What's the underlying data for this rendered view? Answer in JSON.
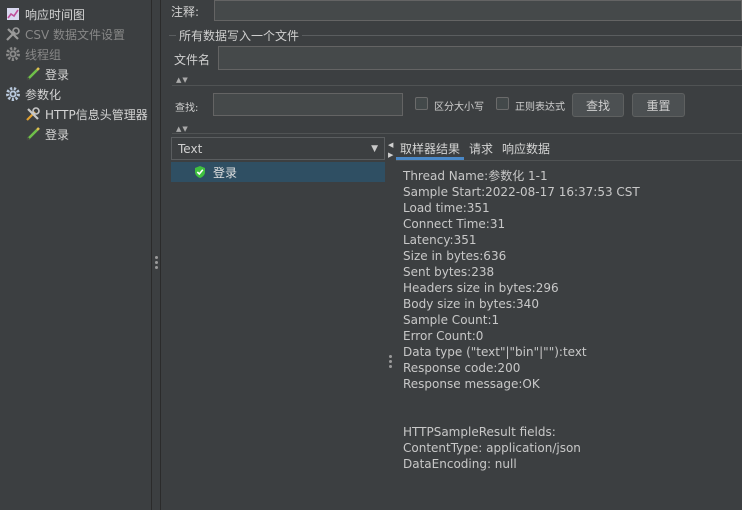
{
  "tree": {
    "items": [
      {
        "label": "响应时间图",
        "icon": "chart-icon",
        "dim": false
      },
      {
        "label": "CSV 数据文件设置",
        "icon": "wrench-icon",
        "dim": true
      },
      {
        "label": "线程组",
        "icon": "gear-icon",
        "dim": true
      },
      {
        "label": "登录",
        "icon": "sampler-pen-icon",
        "dim": false
      },
      {
        "label": "参数化",
        "icon": "gear-icon",
        "dim": false
      },
      {
        "label": "HTTP信息头管理器",
        "icon": "wrench-icon",
        "dim": false
      },
      {
        "label": "登录",
        "icon": "sampler-pen-icon",
        "dim": false
      }
    ]
  },
  "form": {
    "comment_label": "注释:",
    "write_section_label": "所有数据写入一个文件",
    "filename_label": "文件名",
    "search_label": "查找:",
    "case_label": "区分大小写",
    "regex_label": "正则表达式",
    "find_button": "查找",
    "reset_button": "重置"
  },
  "results": {
    "renderer_selected": "Text",
    "samples": [
      {
        "label": "登录",
        "status": "success",
        "status_color": "#3fbf3f"
      }
    ],
    "tabs": [
      {
        "label": "取样器结果",
        "active": true
      },
      {
        "label": "请求",
        "active": false
      },
      {
        "label": "响应数据",
        "active": false
      }
    ],
    "detail_lines": [
      "Thread Name:参数化 1-1",
      "Sample Start:2022-08-17 16:37:53 CST",
      "Load time:351",
      "Connect Time:31",
      "Latency:351",
      "Size in bytes:636",
      "Sent bytes:238",
      "Headers size in bytes:296",
      "Body size in bytes:340",
      "Sample Count:1",
      "Error Count:0",
      "Data type (\"text\"|\"bin\"|\"\"):text",
      "Response code:200",
      "Response message:OK",
      "",
      "",
      "HTTPSampleResult fields:",
      "ContentType: application/json",
      "DataEncoding: null"
    ]
  },
  "colors": {
    "background": "#3c3f41",
    "active_tab_underline": "#4a88c7",
    "selected_row": "#2f4f63"
  }
}
